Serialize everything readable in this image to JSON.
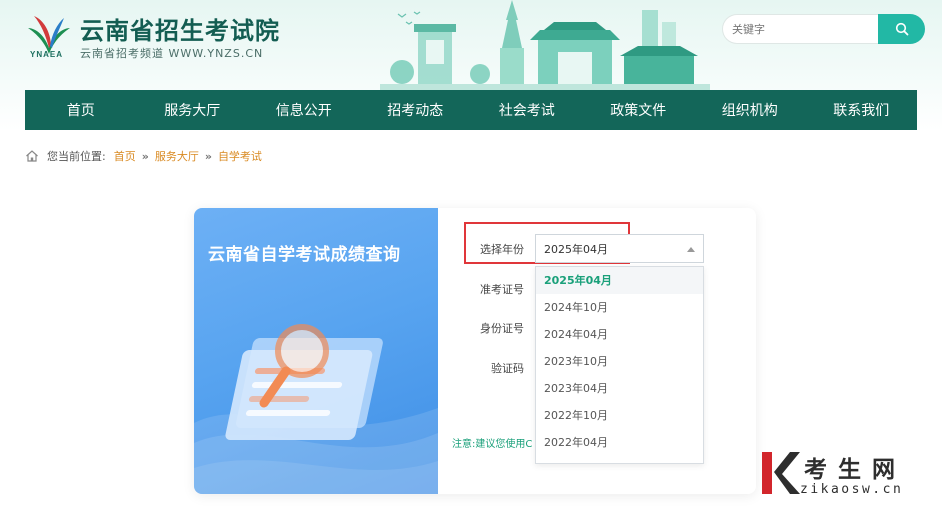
{
  "header": {
    "logo_abbr": "YNAEA",
    "title": "云南省招生考试院",
    "subtitle": "云南省招考频道 WWW.YNZS.CN",
    "search_placeholder": "关键字",
    "brand_color": "#136659",
    "accent_color": "#22b8a5"
  },
  "nav": {
    "items": [
      {
        "label": "首页"
      },
      {
        "label": "服务大厅"
      },
      {
        "label": "信息公开"
      },
      {
        "label": "招考动态"
      },
      {
        "label": "社会考试"
      },
      {
        "label": "政策文件"
      },
      {
        "label": "组织机构"
      },
      {
        "label": "联系我们"
      }
    ]
  },
  "breadcrumb": {
    "prefix": "您当前位置:",
    "items": [
      {
        "label": "首页"
      },
      {
        "label": "服务大厅"
      },
      {
        "label": "自学考试"
      }
    ],
    "separator": "»"
  },
  "query": {
    "title": "云南省自学考试成绩查询",
    "fields": {
      "year_label": "选择年份",
      "ticket_label": "准考证号",
      "id_label": "身份证号",
      "captcha_label": "验证码"
    },
    "selected_year": "2025年04月",
    "year_options": [
      "2025年04月",
      "2024年10月",
      "2024年04月",
      "2023年10月",
      "2023年04月",
      "2022年10月",
      "2022年04月"
    ],
    "note": "注意:建议您使用C"
  },
  "watermark": {
    "title": "考生网",
    "url": "zikaosw.cn"
  }
}
